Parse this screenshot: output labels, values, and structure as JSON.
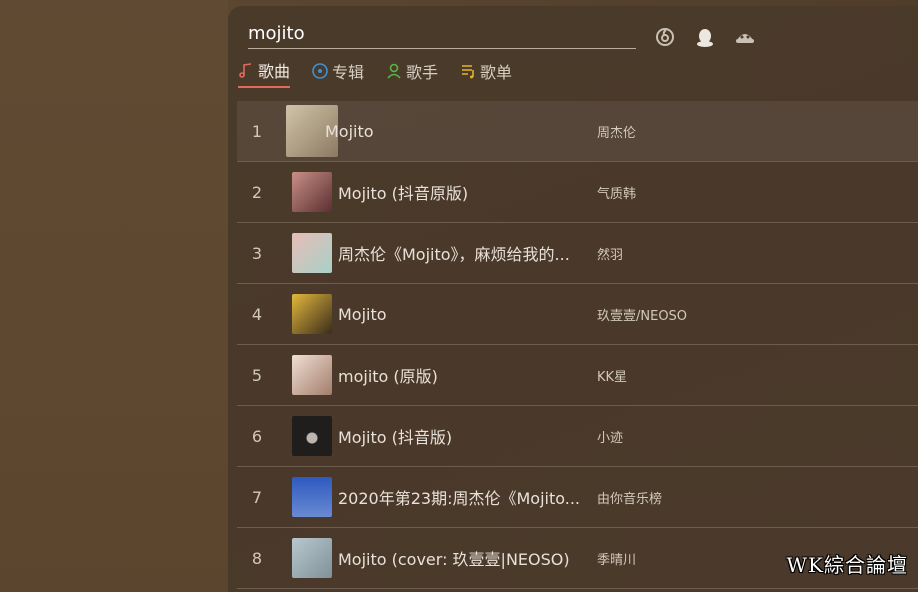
{
  "search": {
    "value": "mojito",
    "sources": [
      "netease-icon",
      "qq-icon",
      "kugou-icon"
    ]
  },
  "tabs": [
    {
      "label": "歌曲",
      "icon": "music-note-icon",
      "active": true,
      "color": "#e16a5e"
    },
    {
      "label": "专辑",
      "icon": "album-icon",
      "active": false,
      "color": "#3f8fd6"
    },
    {
      "label": "歌手",
      "icon": "singer-icon",
      "active": false,
      "color": "#57b646"
    },
    {
      "label": "歌单",
      "icon": "playlist-icon",
      "active": false,
      "color": "#e4b329"
    }
  ],
  "songs": [
    {
      "num": "1",
      "title": "Mojito",
      "artist": "周杰伦",
      "cover": "#b9a890"
    },
    {
      "num": "2",
      "title": "Mojito (抖音原版)",
      "artist": "气质韩",
      "cover": "#7b4a48"
    },
    {
      "num": "3",
      "title": "周杰伦《Mojito》，麻烦给我的...",
      "artist": "然羽",
      "cover": "#d9a8a3"
    },
    {
      "num": "4",
      "title": "Mojito",
      "artist": "玖壹壹/NEOSO",
      "cover": "#a07e2f"
    },
    {
      "num": "5",
      "title": "mojito (原版)",
      "artist": "KK星",
      "cover": "#cdb7a8"
    },
    {
      "num": "6",
      "title": "Mojito (抖音版)",
      "artist": "小迹",
      "cover": "#2b2a2a"
    },
    {
      "num": "7",
      "title": "2020年第23期:周杰伦《Mojito...",
      "artist": "由你音乐榜",
      "cover": "#3f5da8"
    },
    {
      "num": "8",
      "title": "Mojito (cover: 玖壹壹|NEOSO)",
      "artist": "季晴川",
      "cover": "#9fb0b8"
    }
  ],
  "watermark": "WK綜合論壇"
}
